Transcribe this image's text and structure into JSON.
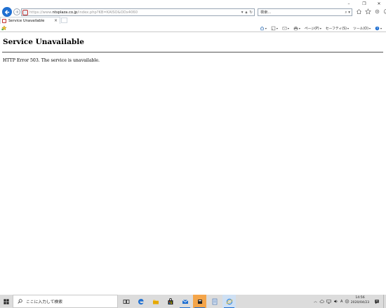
{
  "window": {
    "controls": {
      "minimize": "–",
      "maximize": "❐",
      "close": "✕"
    }
  },
  "address_bar": {
    "url_prefix": "https://www.",
    "url_host": "ntsplaza.co.jp",
    "url_path": "/index.php?KB=KAISO&ODx4060",
    "icons": [
      "search-dropdown-icon",
      "lock-icon",
      "refresh-icon"
    ]
  },
  "search": {
    "placeholder": "検索...",
    "icon": "search-icon"
  },
  "tab": {
    "title": "Service Unavailable",
    "close": "×"
  },
  "command_bar": {
    "items": [
      {
        "label": "",
        "icon": "home-icon"
      },
      {
        "label": "",
        "icon": "feeds-icon"
      },
      {
        "label": "",
        "icon": "mail-icon"
      },
      {
        "label": "",
        "icon": "print-icon"
      },
      {
        "label": "ページ(P)",
        "icon": ""
      },
      {
        "label": "セーフティ(S)",
        "icon": ""
      },
      {
        "label": "ツール(O)",
        "icon": ""
      },
      {
        "label": "",
        "icon": "help-icon"
      }
    ]
  },
  "page": {
    "title": "Service Unavailable",
    "message": "HTTP Error 503. The service is unavailable."
  },
  "taskbar": {
    "search_text": "ここに入力して検索",
    "clock_time": "14:56",
    "clock_date": "2020/04/23",
    "ime_label": "A",
    "accent": "#1f6fd1"
  }
}
